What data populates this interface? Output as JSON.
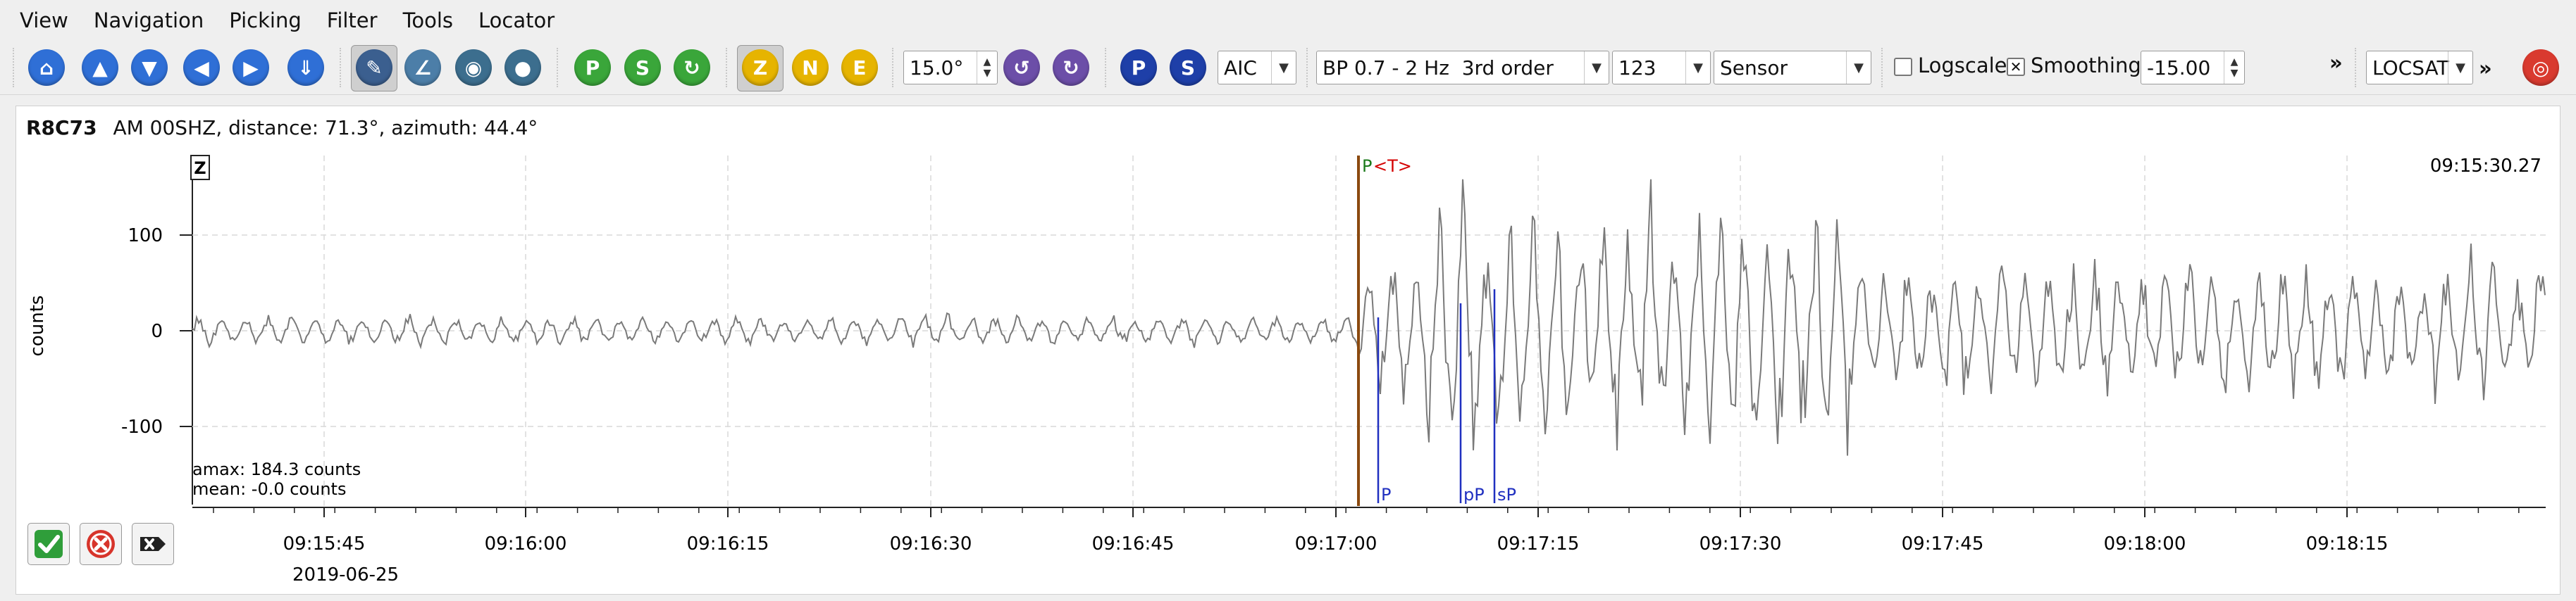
{
  "menu": [
    "View",
    "Navigation",
    "Picking",
    "Filter",
    "Tools",
    "Locator"
  ],
  "toolbar": {
    "icons": [
      "home-icon",
      "prev-up-icon",
      "next-down-icon",
      "prev-left-icon",
      "next-right-icon",
      "scroll-down-icon",
      "pick-mode-icon",
      "angle-icon",
      "eye-icon",
      "record-icon",
      "pick-p-icon",
      "pick-s-icon",
      "pick-refresh-icon"
    ],
    "components": [
      "Z",
      "N",
      "E"
    ],
    "angle": "15.0°",
    "picker": "AIC",
    "filter": "BP 0.7 - 2 Hz  3rd order",
    "channel": "123",
    "unit": "Sensor",
    "logscale_label": "Logscale",
    "logscale_checked": false,
    "smoothing_label": "Smoothing",
    "smoothing_checked": true,
    "smoothing_value": "-15.00",
    "more": "»",
    "locator": "LOCSAT",
    "more2": "»",
    "p_label": "P",
    "s_label": "S"
  },
  "trace": {
    "station": "R8C73",
    "info": "AM  00SHZ, distance: 71.3°, azimuth: 44.4°",
    "component_box": "Z",
    "time_label": "09:15:30.27",
    "ylabel": "counts",
    "yticks": [
      "100",
      "0",
      "-100"
    ],
    "amax": "amax: 184.3 counts",
    "mean": "mean: -0.0 counts",
    "xticks": [
      "09:15:45",
      "09:16:00",
      "09:16:15",
      "09:16:30",
      "09:16:45",
      "09:17:00",
      "09:17:15",
      "09:17:30",
      "09:17:45",
      "09:18:00",
      "09:18:15"
    ],
    "date": "2019-06-25",
    "pick_main": "P",
    "pick_main_suffix": "<T>",
    "theoretical_picks": [
      "P",
      "pP",
      "sP"
    ]
  },
  "footer": {
    "accept": "accept-icon",
    "reject": "reject-icon",
    "clear": "clear-icon"
  }
}
